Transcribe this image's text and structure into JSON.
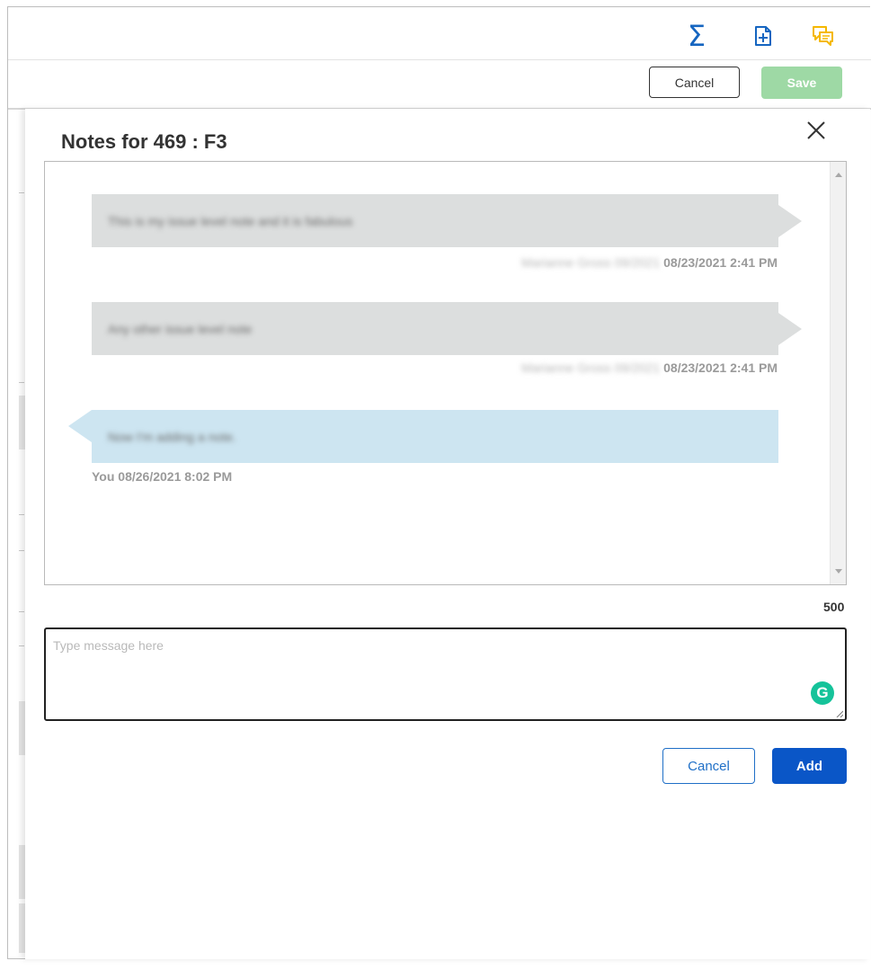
{
  "toolbar": {
    "icons": [
      "sigma-icon",
      "add-note-icon",
      "comments-icon"
    ],
    "sigma_glyph": "Σ",
    "colors": {
      "sigma": "#1565c0",
      "add_note": "#1565c0",
      "comments": "#f5b800"
    }
  },
  "actionbar": {
    "cancel_label": "Cancel",
    "save_label": "Save"
  },
  "notes_panel": {
    "title": "Notes for 469 : F3",
    "messages": [
      {
        "direction": "incoming",
        "text": "This is my issue level note and it is fabulous",
        "author": "Marianne Gross 09/2021",
        "time": "08/23/2021 2:41 PM"
      },
      {
        "direction": "incoming",
        "text": "Any other issue level note",
        "author": "Marianne Gross 09/2021",
        "time": "08/23/2021 2:41 PM"
      },
      {
        "direction": "outgoing",
        "text": "Now I'm adding a note.",
        "author": "You",
        "time": "08/26/2021 8:02 PM"
      }
    ],
    "char_counter": "500",
    "input": {
      "value": "",
      "placeholder": "Type message here"
    },
    "grammarly_glyph": "G",
    "cancel_label": "Cancel",
    "add_label": "Add",
    "colors": {
      "incoming_bubble": "#dcdede",
      "outgoing_bubble": "#cde5f1",
      "add_button": "#0a56c7",
      "cancel_border": "#1f6fc7",
      "save_disabled": "#9ed9a5"
    }
  }
}
